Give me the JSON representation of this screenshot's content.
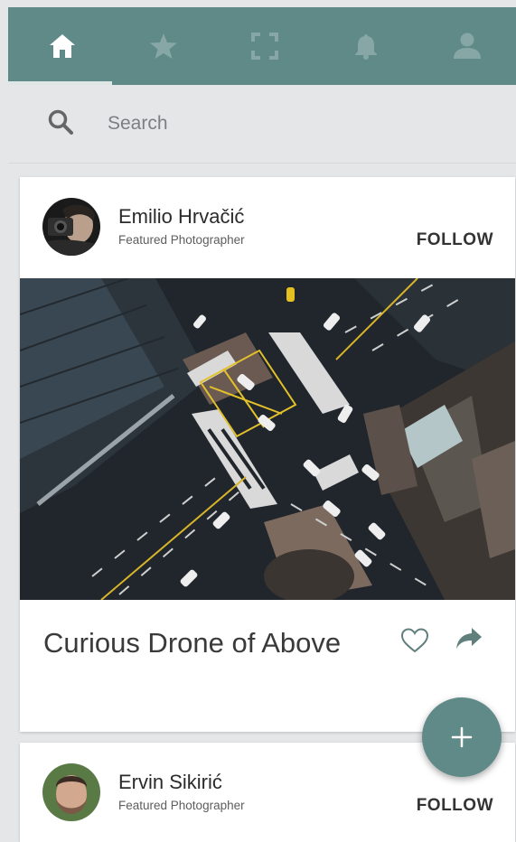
{
  "tabs": [
    {
      "id": "home",
      "icon": "home-icon",
      "active": true
    },
    {
      "id": "favorites",
      "icon": "star-icon",
      "active": false
    },
    {
      "id": "fullscreen",
      "icon": "fullscreen-icon",
      "active": false
    },
    {
      "id": "notifications",
      "icon": "bell-icon",
      "active": false
    },
    {
      "id": "profile",
      "icon": "person-icon",
      "active": false
    }
  ],
  "search": {
    "placeholder": "Search",
    "icon": "search-icon"
  },
  "posts": [
    {
      "author": "Emilio Hrvačić",
      "role": "Featured Photographer",
      "follow_label": "FOLLOW",
      "title": "Curious Drone of Above",
      "image": "aerial-intersection-photo",
      "actions": [
        "heart-icon",
        "share-icon"
      ]
    },
    {
      "author": "Ervin Sikirić",
      "role": "Featured Photographer",
      "follow_label": "FOLLOW"
    }
  ],
  "fab": {
    "icon": "plus-icon"
  },
  "colors": {
    "accent": "#5f8a88",
    "background": "#e4e6e8",
    "card": "#ffffff",
    "tab_inactive": "#86a7a5"
  }
}
